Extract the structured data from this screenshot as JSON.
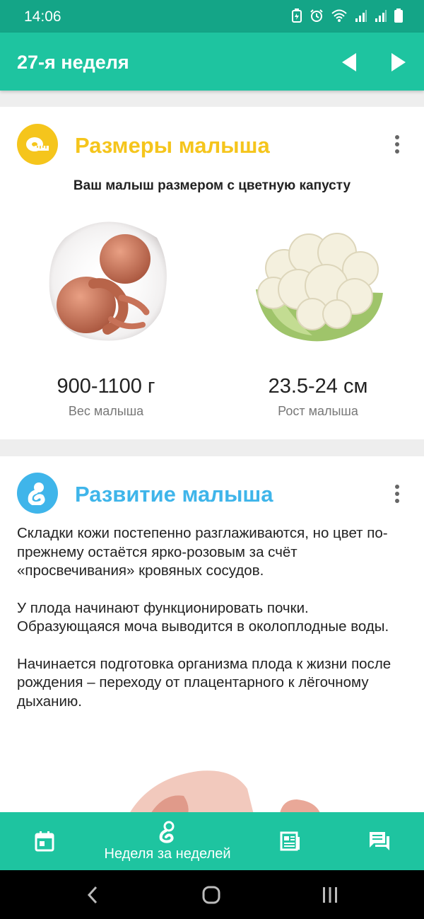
{
  "status_bar": {
    "time": "14:06"
  },
  "app_bar": {
    "title": "27-я неделя"
  },
  "size_card": {
    "title": "Размеры малыша",
    "subtitle": "Ваш малыш размером с цветную капусту",
    "weight_value": "900-1100 г",
    "weight_label": "Вес малыша",
    "height_value": "23.5-24 см",
    "height_label": "Рост малыша",
    "accent": "#f5c51c"
  },
  "development_card": {
    "title": "Развитие малыша",
    "paragraphs": [
      "Складки кожи постепенно разглаживаются, но цвет по-прежнему остаётся ярко-розовым за счёт «просвечивания» кровяных сосудов.",
      "У плода начинают функционировать почки. Образующаяся моча выводится в околоплодные воды.",
      "Начинается подготовка организма плода к жизни после рождения – переходу от плацентарного к лёгочному дыханию."
    ],
    "accent": "#3fb5ea"
  },
  "bottom_nav": {
    "items": [
      {
        "icon": "calendar-icon",
        "label": ""
      },
      {
        "icon": "fetus-icon",
        "label": "Неделя за неделей"
      },
      {
        "icon": "articles-icon",
        "label": ""
      },
      {
        "icon": "chat-icon",
        "label": ""
      }
    ]
  },
  "colors": {
    "primary": "#1ec4a0",
    "status_bar": "#14a587"
  }
}
